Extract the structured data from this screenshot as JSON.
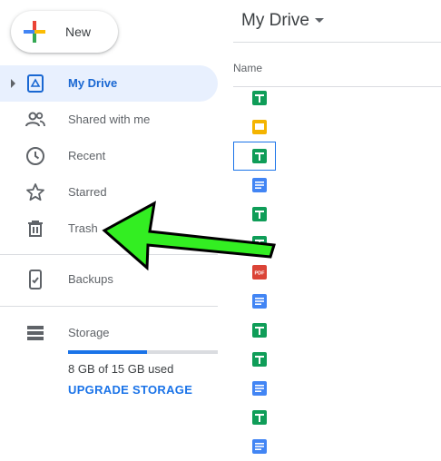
{
  "new_button": {
    "label": "New"
  },
  "sidebar": {
    "items": [
      {
        "label": "My Drive",
        "icon": "my-drive-icon",
        "active": true
      },
      {
        "label": "Shared with me",
        "icon": "shared-with-me-icon"
      },
      {
        "label": "Recent",
        "icon": "clock-icon"
      },
      {
        "label": "Starred",
        "icon": "star-icon"
      },
      {
        "label": "Trash",
        "icon": "trash-icon"
      },
      {
        "label": "Backups",
        "icon": "backups-icon"
      },
      {
        "label": "Storage",
        "icon": "storage-icon"
      }
    ]
  },
  "storage": {
    "used_text": "8 GB of 15 GB used",
    "used_fraction": 0.53,
    "upgrade_label": "UPGRADE STORAGE"
  },
  "main": {
    "title": "My Drive",
    "column_name": "Name",
    "files": [
      {
        "type": "sheets"
      },
      {
        "type": "slides"
      },
      {
        "type": "sheets",
        "selected": true
      },
      {
        "type": "docs"
      },
      {
        "type": "sheets"
      },
      {
        "type": "sheets"
      },
      {
        "type": "pdf",
        "badge": "PDF"
      },
      {
        "type": "docs"
      },
      {
        "type": "sheets"
      },
      {
        "type": "sheets"
      },
      {
        "type": "docs"
      },
      {
        "type": "sheets"
      },
      {
        "type": "docs"
      }
    ]
  },
  "colors": {
    "accent": "#1a73e8",
    "active_bg": "#e8f0fe",
    "active_text": "#1967d2",
    "sheets": "#0f9d58",
    "slides": "#f4b400",
    "docs": "#4285f4",
    "pdf": "#db4437",
    "arrow": "#33ee22"
  }
}
